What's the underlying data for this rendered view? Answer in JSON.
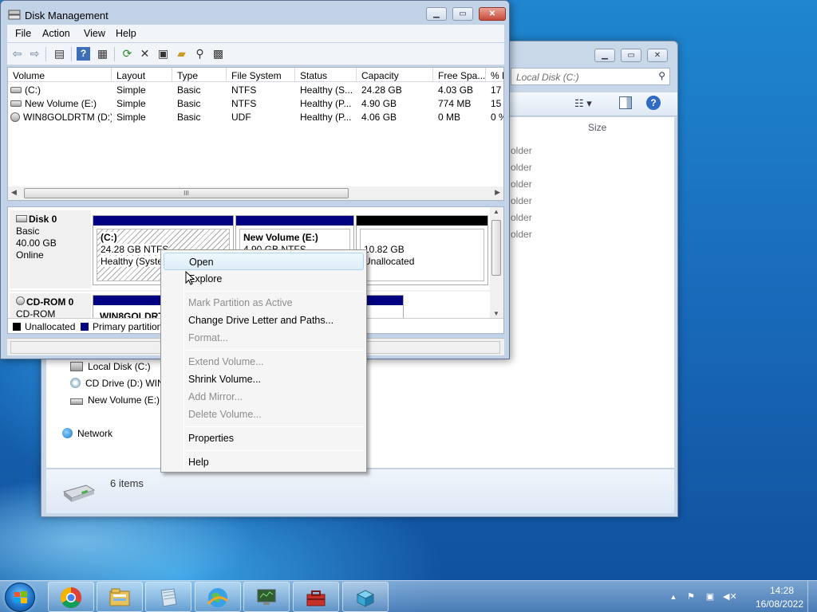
{
  "explorer": {
    "search_placeholder": "Search Local Disk (C:)",
    "search_visible_text": "Local Disk (C:)",
    "size_header": "Size",
    "folder_fragments": [
      "older",
      "older",
      "older",
      "older",
      "older",
      "older"
    ],
    "nav_items": [
      {
        "label": "Local Disk (C:)",
        "icon": "drive-icon"
      },
      {
        "label": "CD Drive (D:) WIN",
        "icon": "cd-drive-icon"
      },
      {
        "label": "New Volume (E:)",
        "icon": "drive-icon"
      }
    ],
    "network_label": "Network",
    "items_count": "6 items"
  },
  "disk_management": {
    "title": "Disk Management",
    "menu": [
      "File",
      "Action",
      "View",
      "Help"
    ],
    "columns": [
      "Volume",
      "Layout",
      "Type",
      "File System",
      "Status",
      "Capacity",
      "Free Spa...",
      "% F"
    ],
    "volumes": [
      {
        "volume": "(C:)",
        "layout": "Simple",
        "type": "Basic",
        "fs": "NTFS",
        "status": "Healthy (S...",
        "capacity": "24.28 GB",
        "free": "4.03 GB",
        "pct": "17"
      },
      {
        "volume": "New Volume (E:)",
        "layout": "Simple",
        "type": "Basic",
        "fs": "NTFS",
        "status": "Healthy (P...",
        "capacity": "4.90 GB",
        "free": "774 MB",
        "pct": "15"
      },
      {
        "volume": "WIN8GOLDRTM (D:)",
        "layout": "Simple",
        "type": "Basic",
        "fs": "UDF",
        "status": "Healthy (P...",
        "capacity": "4.06 GB",
        "free": "0 MB",
        "pct": "0 %"
      }
    ],
    "scroll_grip": "III",
    "disk0": {
      "name": "Disk 0",
      "type": "Basic",
      "size": "40.00 GB",
      "state": "Online",
      "partitions": [
        {
          "label": "(C:)",
          "size": "24.28 GB NTFS",
          "status": "Healthy (Syster"
        },
        {
          "label": "New Volume  (E:)",
          "size": "4.90 GB NTFS",
          "status": ""
        },
        {
          "label": "",
          "size": "10.82 GB",
          "status": "Unallocated"
        }
      ]
    },
    "cdrom0": {
      "name": "CD-ROM 0",
      "type": "CD-ROM",
      "partition_label": "WIN8GOLDRT"
    },
    "legend": [
      {
        "label": "Unallocated",
        "color": "#000000"
      },
      {
        "label": "Primary partition",
        "color": "#000080"
      }
    ],
    "colors": {
      "primary": "#000080",
      "unallocated": "#000000"
    }
  },
  "context_menu": {
    "items": [
      {
        "label": "Open",
        "enabled": true,
        "highlighted": true
      },
      {
        "label": "Explore",
        "enabled": true
      },
      {
        "label": "Mark Partition as Active",
        "enabled": false
      },
      {
        "label": "Change Drive Letter and Paths...",
        "enabled": true
      },
      {
        "label": "Format...",
        "enabled": false
      },
      {
        "label": "Extend Volume...",
        "enabled": false
      },
      {
        "label": "Shrink Volume...",
        "enabled": true
      },
      {
        "label": "Add Mirror...",
        "enabled": false
      },
      {
        "label": "Delete Volume...",
        "enabled": false
      },
      {
        "label": "Properties",
        "enabled": true
      },
      {
        "label": "Help",
        "enabled": true
      }
    ]
  },
  "taskbar": {
    "pinned": [
      "explorer-icon",
      "chrome-icon",
      "libraries-icon",
      "notepad-icon",
      "network-globe-icon",
      "monitor-icon",
      "toolbox-icon",
      "package-icon"
    ],
    "time": "14:28",
    "date": "16/08/2022"
  }
}
